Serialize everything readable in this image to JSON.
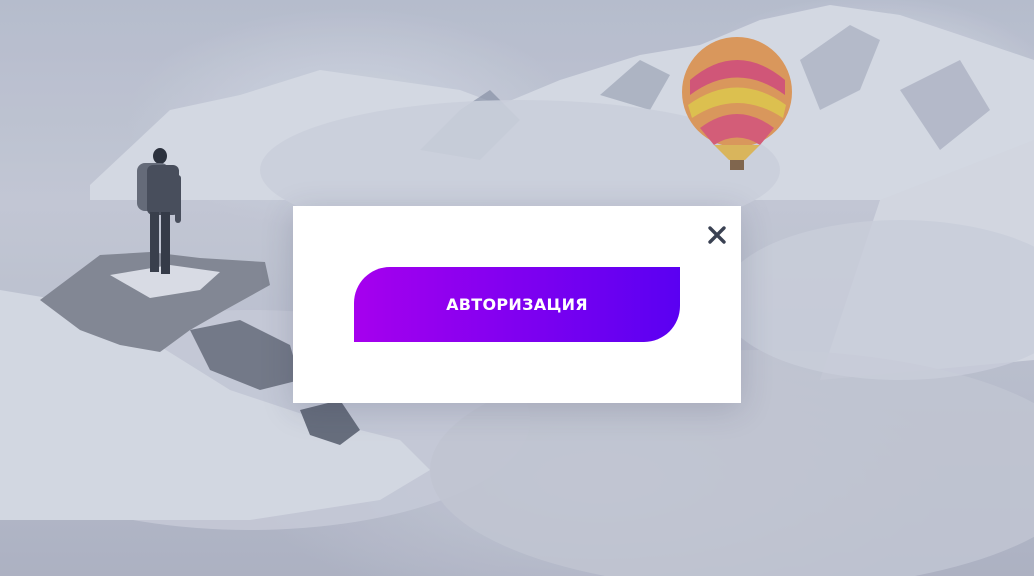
{
  "modal": {
    "auth_button_label": "АВТОРИЗАЦИЯ",
    "close_icon": "close-icon"
  },
  "colors": {
    "button_gradient_start": "#a600ee",
    "button_gradient_end": "#5a00f2",
    "close_icon": "#3a4152",
    "modal_background": "#ffffff"
  }
}
